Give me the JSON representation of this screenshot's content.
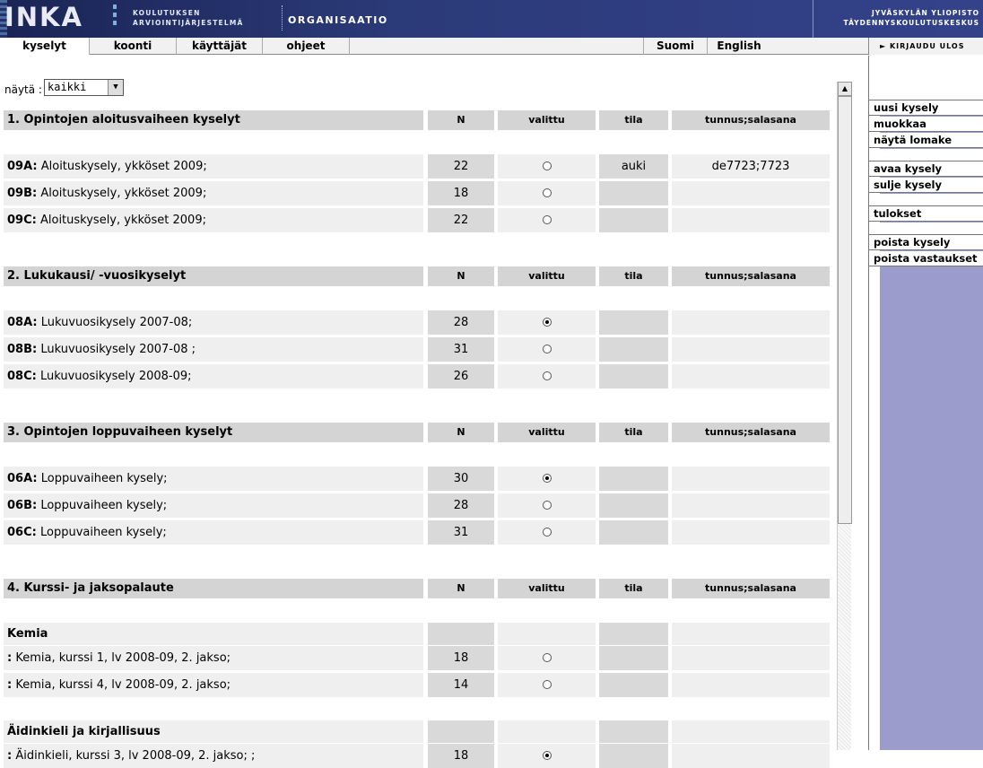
{
  "header": {
    "logo": "INKA",
    "subtitle_line1": "KOULUTUKSEN",
    "subtitle_line2": "ARVIOINTIJÄRJESTELMÄ",
    "org_label": "ORGANISAATIO",
    "university_line1": "JYVÄSKYLÄN YLIOPISTO",
    "university_line2": "TÄYDENNYSKOULUTUSKESKUS"
  },
  "nav": {
    "tabs": [
      "kyselyt",
      "koonti",
      "käyttäjät",
      "ohjeet"
    ],
    "lang_fi": "Suomi",
    "lang_en": "English",
    "login": "► KIRJAUDU ULOS"
  },
  "sidebar": {
    "items": [
      "uusi kysely",
      "muokkaa",
      "näytä lomake",
      "avaa kysely",
      "sulje kysely",
      "tulokset",
      "poista kysely",
      "poista vastaukset"
    ]
  },
  "filter": {
    "label": "näytä :",
    "value": "kaikki"
  },
  "columns": {
    "n": "N",
    "selected": "valittu",
    "status": "tila",
    "credentials": "tunnus;salasana"
  },
  "sections": [
    {
      "title": "1. Opintojen aloitusvaiheen kyselyt",
      "rows": [
        {
          "code": "09A:",
          "name": "Aloituskysely, ykköset 2009;",
          "n": "22",
          "selected": false,
          "status": "auki",
          "credentials": "de7723;7723"
        },
        {
          "code": "09B:",
          "name": "Aloituskysely, ykköset 2009;",
          "n": "18",
          "selected": false,
          "status": "",
          "credentials": ""
        },
        {
          "code": "09C:",
          "name": "Aloituskysely, ykköset 2009;",
          "n": "22",
          "selected": false,
          "status": "",
          "credentials": ""
        }
      ]
    },
    {
      "title": "2. Lukukausi/ -vuosikyselyt",
      "rows": [
        {
          "code": "08A:",
          "name": "Lukuvuosikysely 2007-08;",
          "n": "28",
          "selected": true,
          "status": "",
          "credentials": ""
        },
        {
          "code": "08B:",
          "name": "Lukuvuosikysely 2007-08 ;",
          "n": "31",
          "selected": false,
          "status": "",
          "credentials": ""
        },
        {
          "code": "08C:",
          "name": "Lukuvuosikysely 2008-09;",
          "n": "26",
          "selected": false,
          "status": "",
          "credentials": ""
        }
      ]
    },
    {
      "title": "3. Opintojen loppuvaiheen kyselyt",
      "rows": [
        {
          "code": "06A:",
          "name": "Loppuvaiheen kysely;",
          "n": "30",
          "selected": true,
          "status": "",
          "credentials": ""
        },
        {
          "code": "06B:",
          "name": "Loppuvaiheen kysely;",
          "n": "28",
          "selected": false,
          "status": "",
          "credentials": ""
        },
        {
          "code": "06C:",
          "name": "Loppuvaiheen kysely;",
          "n": "31",
          "selected": false,
          "status": "",
          "credentials": ""
        }
      ]
    },
    {
      "title": "4. Kurssi- ja jaksopalaute",
      "groups": [
        {
          "title": "Kemia",
          "rows": [
            {
              "code": ":",
              "name": "Kemia, kurssi 1, lv 2008-09, 2. jakso;",
              "n": "18",
              "selected": false,
              "status": "",
              "credentials": ""
            },
            {
              "code": ":",
              "name": "Kemia, kurssi 4, lv 2008-09, 2. jakso;",
              "n": "14",
              "selected": false,
              "status": "",
              "credentials": ""
            }
          ]
        },
        {
          "title": "Äidinkieli ja kirjallisuus",
          "rows": [
            {
              "code": ":",
              "name": "Äidinkieli, kurssi 3, lv 2008-09, 2. jakso; ;",
              "n": "18",
              "selected": true,
              "status": "",
              "credentials": ""
            }
          ]
        }
      ]
    }
  ]
}
